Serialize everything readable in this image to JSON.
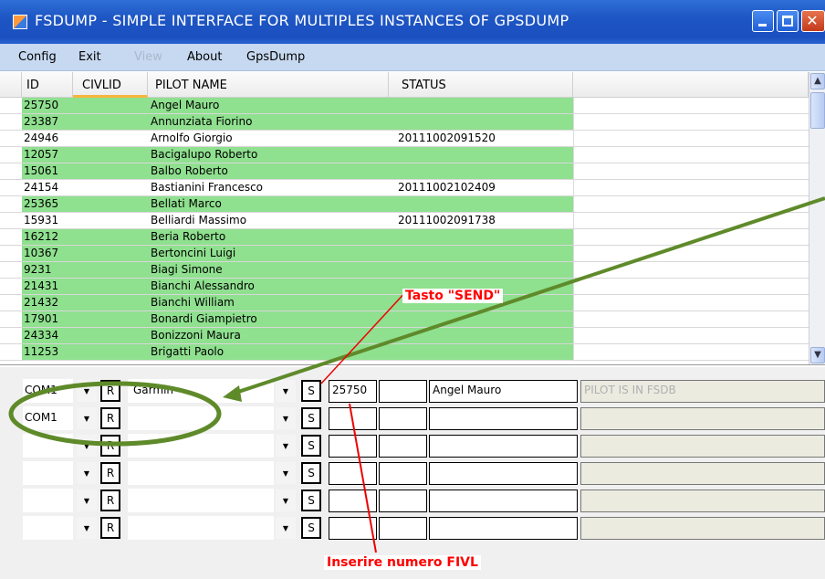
{
  "window": {
    "title": "FSDUMP - SIMPLE INTERFACE FOR  MULTIPLES INSTANCES OF GPSDUMP"
  },
  "menu": [
    {
      "label": "Config",
      "enabled": true
    },
    {
      "label": "Exit",
      "enabled": true
    },
    {
      "label": "View",
      "enabled": false
    },
    {
      "label": "About",
      "enabled": true
    },
    {
      "label": "GpsDump",
      "enabled": true
    }
  ],
  "grid": {
    "headers": {
      "id": "ID",
      "civlid": "CIVLID",
      "pilot_name": "PILOT NAME",
      "status": "STATUS"
    },
    "sorted_column": "CIVLID",
    "rows": [
      {
        "id": "25750",
        "civlid": "",
        "name": "Angel Mauro",
        "status": "",
        "highlight": true
      },
      {
        "id": "23387",
        "civlid": "",
        "name": "Annunziata Fiorino",
        "status": "",
        "highlight": true
      },
      {
        "id": "24946",
        "civlid": "",
        "name": "Arnolfo Giorgio",
        "status": "20111002091520",
        "highlight": false
      },
      {
        "id": "12057",
        "civlid": "",
        "name": "Bacigalupo Roberto",
        "status": "",
        "highlight": true
      },
      {
        "id": "15061",
        "civlid": "",
        "name": "Balbo Roberto",
        "status": "",
        "highlight": true
      },
      {
        "id": "24154",
        "civlid": "",
        "name": "Bastianini Francesco",
        "status": "20111002102409",
        "highlight": false
      },
      {
        "id": "25365",
        "civlid": "",
        "name": "Bellati Marco",
        "status": "",
        "highlight": true
      },
      {
        "id": "15931",
        "civlid": "",
        "name": "Belliardi Massimo",
        "status": "20111002091738",
        "highlight": false
      },
      {
        "id": "16212",
        "civlid": "",
        "name": "Beria Roberto",
        "status": "",
        "highlight": true
      },
      {
        "id": "10367",
        "civlid": "",
        "name": "Bertoncini Luigi",
        "status": "",
        "highlight": true
      },
      {
        "id": "9231",
        "civlid": "",
        "name": "Biagi Simone",
        "status": "",
        "highlight": true
      },
      {
        "id": "21431",
        "civlid": "",
        "name": "Bianchi Alessandro",
        "status": "",
        "highlight": true
      },
      {
        "id": "21432",
        "civlid": "",
        "name": "Bianchi William",
        "status": "",
        "highlight": true
      },
      {
        "id": "17901",
        "civlid": "",
        "name": "Bonardi Giampietro",
        "status": "",
        "highlight": true
      },
      {
        "id": "24334",
        "civlid": "",
        "name": "Bonizzoni Maura",
        "status": "",
        "highlight": true
      },
      {
        "id": "11253",
        "civlid": "",
        "name": "Brigatti Paolo",
        "status": "",
        "highlight": true
      }
    ]
  },
  "devices": [
    {
      "port": "COM1",
      "r_label": "R",
      "device": "Garmin",
      "s_label": "S",
      "fivl": "25750",
      "civl": "",
      "pilot": "Angel Mauro",
      "status": "PILOT IS IN FSDB"
    },
    {
      "port": "COM1",
      "r_label": "R",
      "device": "",
      "s_label": "S",
      "fivl": "",
      "civl": "",
      "pilot": "",
      "status": ""
    },
    {
      "port": "",
      "r_label": "R",
      "device": "",
      "s_label": "S",
      "fivl": "",
      "civl": "",
      "pilot": "",
      "status": ""
    },
    {
      "port": "",
      "r_label": "R",
      "device": "",
      "s_label": "S",
      "fivl": "",
      "civl": "",
      "pilot": "",
      "status": ""
    },
    {
      "port": "",
      "r_label": "R",
      "device": "",
      "s_label": "S",
      "fivl": "",
      "civl": "",
      "pilot": "",
      "status": ""
    },
    {
      "port": "",
      "r_label": "R",
      "device": "",
      "s_label": "S",
      "fivl": "",
      "civl": "",
      "pilot": "",
      "status": ""
    }
  ],
  "annotations": {
    "send_label": "Tasto \"SEND\"",
    "fivl_label": "Inserire numero FIVL",
    "color": "#ff0000",
    "arrow_color": "#5f8a2a"
  },
  "colors": {
    "row_highlight": "#8fe08f",
    "titlebar": "#1e56c4",
    "menubar": "#c7d9f1"
  }
}
